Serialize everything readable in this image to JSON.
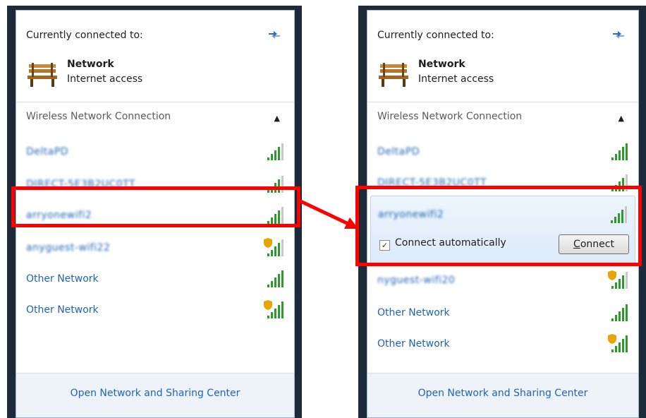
{
  "colors": {
    "link": "#1f64b4",
    "highlight": "#ff0000",
    "signal_green": "#2e9a2e",
    "shield": "#e8a400",
    "panel_frame": "#1c2a3a"
  },
  "left_panel": {
    "header": "Currently connected to:",
    "refresh_icon": "refresh-icon",
    "connected_network": {
      "name": "Network",
      "status": "Internet access",
      "icon": "bench-icon"
    },
    "section_title": "Wireless Network Connection",
    "networks": [
      {
        "label": "DeltaPD",
        "blurred": true,
        "secured_warning": false,
        "signal": 4
      },
      {
        "label": "DIRECT-5E3B2UC0TT",
        "blurred": true,
        "secured_warning": false,
        "signal": 4
      },
      {
        "label": "arryonewifi2",
        "blurred": true,
        "secured_warning": false,
        "signal": 4
      },
      {
        "label": "anyguest-wifi22",
        "blurred": true,
        "secured_warning": true,
        "signal": 4
      },
      {
        "label": "Other Network",
        "blurred": false,
        "secured_warning": false,
        "signal": 5
      },
      {
        "label": "Other Network",
        "blurred": false,
        "secured_warning": true,
        "signal": 5
      }
    ],
    "footer_link": "Open Network and Sharing Center"
  },
  "right_panel": {
    "header": "Currently connected to:",
    "refresh_icon": "refresh-icon",
    "connected_network": {
      "name": "Network",
      "status": "Internet access",
      "icon": "bench-icon"
    },
    "section_title": "Wireless Network Connection",
    "networks": [
      {
        "label": "DeltaPD",
        "blurred": true,
        "secured_warning": false,
        "signal": 5
      },
      {
        "label": "DIRECT-5E3B2UC0TT",
        "blurred": true,
        "secured_warning": false,
        "signal": 4
      },
      {
        "label": "arryonewifi2",
        "blurred": true,
        "secured_warning": false,
        "signal": 4,
        "expanded": true
      },
      {
        "label": "nyguest-wifi20",
        "blurred": true,
        "secured_warning": true,
        "signal": 4
      },
      {
        "label": "Other Network",
        "blurred": false,
        "secured_warning": false,
        "signal": 5
      },
      {
        "label": "Other Network",
        "blurred": false,
        "secured_warning": true,
        "signal": 5
      }
    ],
    "expanded": {
      "connect_automatically_label": "Connect automatically",
      "connect_automatically_checked": true,
      "connect_button_first": "C",
      "connect_button_rest": "onnect"
    },
    "footer_link": "Open Network and Sharing Center"
  }
}
